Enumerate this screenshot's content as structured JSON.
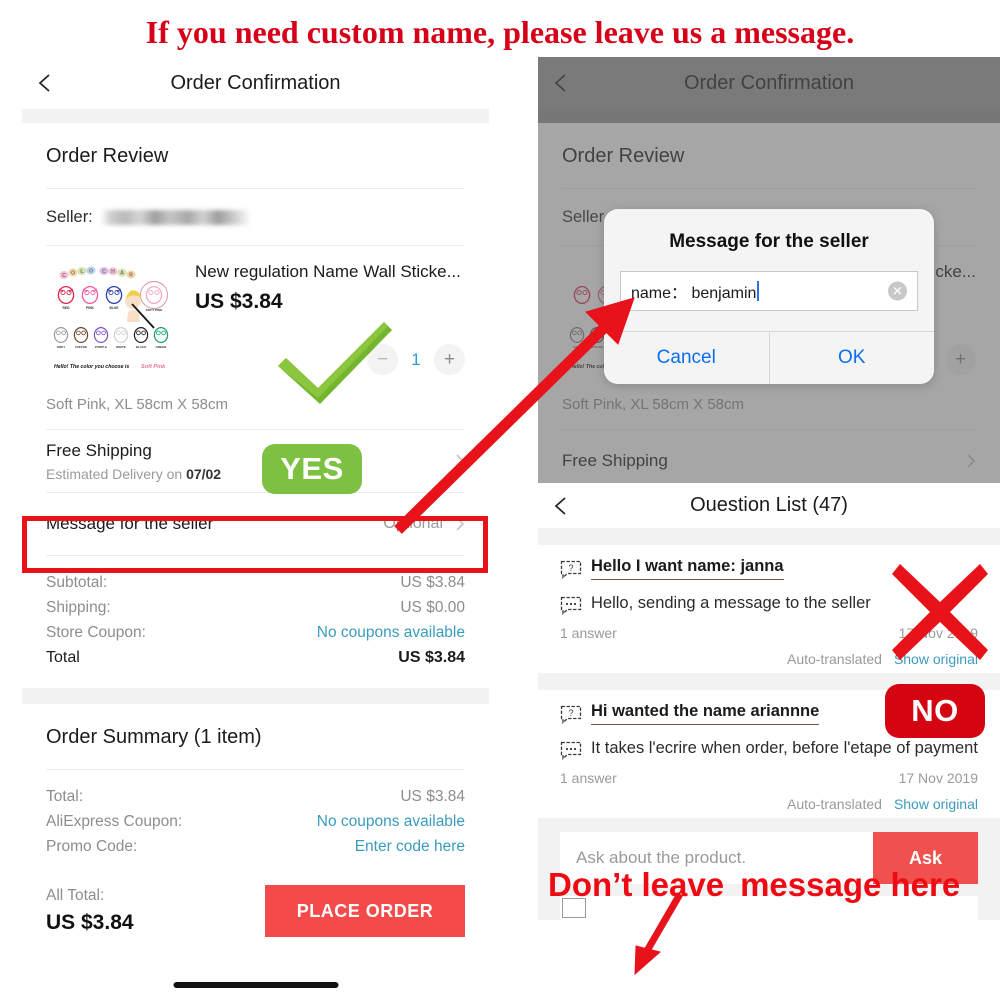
{
  "banner": {
    "text": "If you need custom name, please leave us a message."
  },
  "left_phone": {
    "navbar": {
      "title": "Order Confirmation",
      "back_icon": "chevron-left-icon"
    },
    "order_review": {
      "heading": "Order Review"
    },
    "seller": {
      "label": "Seller:",
      "value_redacted": true
    },
    "product": {
      "name": "New regulation Name Wall Sticke...",
      "price": "US $3.84",
      "quantity": "1",
      "minus_label": "−",
      "plus_label": "+",
      "variant": "Soft Pink, XL 58cm X 58cm",
      "thumb": {
        "chart_title": "COLOR CHART",
        "row1": [
          "RED",
          "PINK",
          "BLUE",
          "SOFT PINK"
        ],
        "row2": [
          "GREY",
          "COFFEE",
          "PURPLE",
          "WHITE",
          "BLACK",
          "GREEN"
        ],
        "caption_prefix": "Hello! The color you choose is ",
        "caption_choice": "Soft Pink"
      }
    },
    "shipping": {
      "title": "Free Shipping",
      "subtitle_prefix": "Estimated Delivery on ",
      "subtitle_date": "07/02"
    },
    "message_row": {
      "label": "Message for the seller",
      "value": "Optional"
    },
    "price_rows": [
      {
        "key": "Subtotal:",
        "value": "US $3.84",
        "link": false
      },
      {
        "key": "Shipping:",
        "value": "US $0.00",
        "link": false
      },
      {
        "key": "Store Coupon:",
        "value": "No coupons available",
        "link": true
      }
    ],
    "total_row": {
      "key": "Total",
      "value": "US $3.84"
    },
    "order_summary": {
      "heading": "Order Summary (1 item)",
      "rows": [
        {
          "key": "Total:",
          "value": "US $3.84",
          "link": false
        },
        {
          "key": "AliExpress Coupon:",
          "value": "No coupons available",
          "link": true
        },
        {
          "key": "Promo Code:",
          "value": "Enter code here",
          "link": true
        }
      ],
      "all_total_label": "All Total:",
      "all_total_value": "US $3.84",
      "place_order_label": "PLACE ORDER"
    }
  },
  "right_phone": {
    "navbar": {
      "title": "Order Confirmation",
      "back_icon": "chevron-left-icon"
    },
    "order_review": {
      "heading": "Order Review"
    },
    "seller": {
      "label": "Seller"
    },
    "product": {
      "name_fragment": "cke...",
      "variant": "Soft Pink, XL 58cm X 58cm",
      "plus_label": "+"
    },
    "shipping": {
      "title": "Free Shipping"
    },
    "modal": {
      "title": "Message for the seller",
      "input_value": "name： benjamin",
      "clear_icon": "clear-circle-icon",
      "cancel_label": "Cancel",
      "ok_label": "OK"
    },
    "question_list": {
      "navbar": {
        "title": "Ouestion List (47)",
        "back_icon": "chevron-left-icon"
      },
      "items": [
        {
          "question": "Hello I want name: janna",
          "answer": "Hello, sending a message to the seller",
          "answer_count": "1 answer",
          "date": "17 Nov 2019",
          "auto_translated": "Auto-translated",
          "show_original": "Show original"
        },
        {
          "question": "Hi wanted the name ariannne",
          "answer": "It takes l'ecrire when order, before l'etape of payment",
          "answer_count": "1 answer",
          "date": "17 Nov 2019",
          "auto_translated": "Auto-translated",
          "show_original": "Show original"
        }
      ],
      "ask_placeholder": "Ask about the product.",
      "ask_button": "Ask"
    }
  },
  "annotations": {
    "yes_badge": "YES",
    "no_badge": "NO",
    "bottom_note_part1": "Don’t leave",
    "bottom_note_part2": "message here",
    "check_icon": "green-check-icon",
    "x_icon": "red-x-icon",
    "arrow_to_modal": "red-arrow-icon",
    "arrow_to_ask": "red-arrow-icon",
    "highlight_box": "red-highlight-box"
  },
  "colors": {
    "banner_red": "#d60019",
    "accent_red": "#f44a4a",
    "link_blue": "#3a9bbd",
    "yes_green": "#7dc143",
    "no_red": "#d40511",
    "modal_blue": "#0a6ff0"
  }
}
